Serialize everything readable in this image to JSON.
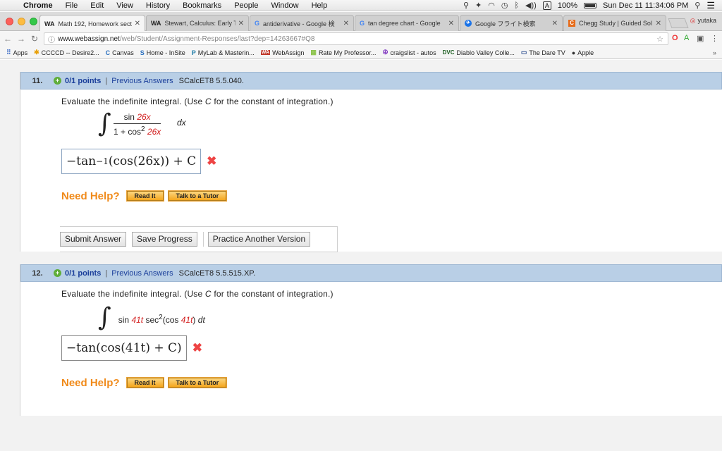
{
  "menubar": {
    "app": "Chrome",
    "items": [
      "File",
      "Edit",
      "View",
      "History",
      "Bookmarks",
      "People",
      "Window",
      "Help"
    ],
    "input_indicator": "A",
    "battery": "100%",
    "clock": "Sun Dec 11  11:34:06 PM"
  },
  "tabs": [
    {
      "favicon": "WA",
      "label": "Math 192, Homework secti"
    },
    {
      "favicon": "WA",
      "label": "Stewart, Calculus: Early Tr"
    },
    {
      "favicon": "G",
      "label": "antiderivative - Google 検"
    },
    {
      "favicon": "G",
      "label": "tan degree chart - Google"
    },
    {
      "favicon": "✈",
      "label": "Google フライト検索"
    },
    {
      "favicon": "C",
      "label": "Chegg Study | Guided Sol"
    }
  ],
  "profile": "yutaka",
  "address": {
    "host": "www.webassign.net",
    "path": "/web/Student/Assignment-Responses/last?dep=14263667#Q8"
  },
  "bookmarks": [
    {
      "icon": "⠿",
      "label": "Apps"
    },
    {
      "icon": "✱",
      "label": "CCCCD -- Desire2..."
    },
    {
      "icon": "C",
      "label": "Canvas"
    },
    {
      "icon": "S",
      "label": "Home - InSite"
    },
    {
      "icon": "P",
      "label": "MyLab & Masterin..."
    },
    {
      "icon": "WA",
      "label": "WebAssign"
    },
    {
      "icon": "▦",
      "label": "Rate My Professor..."
    },
    {
      "icon": "☮",
      "label": "craigslist - autos"
    },
    {
      "icon": "DVC",
      "label": "Diablo Valley Colle..."
    },
    {
      "icon": "▭",
      "label": "The Dare TV"
    },
    {
      "icon": "●",
      "label": "Apple"
    }
  ],
  "bookmarks_more": "»",
  "q11": {
    "number": "11.",
    "points": "0/1 points",
    "sep": "|",
    "prev": "Previous Answers",
    "id": "SCalcET8 5.5.040.",
    "prompt_pre": "Evaluate the indefinite integral. (Use ",
    "prompt_var": "C",
    "prompt_post": " for the constant of integration.)",
    "num_fn": "sin",
    "num_arg": "26x",
    "den_pre": "1 + cos",
    "den_exp": "2",
    "den_arg": "26x",
    "differential": "dx",
    "answer_func": "−tan",
    "answer_exp": "−1",
    "answer_rest": "(cos(26x)) + C",
    "need_help": "Need Help?",
    "read_it": "Read It",
    "talk_tutor": "Talk to a Tutor",
    "submit": "Submit Answer",
    "save": "Save Progress",
    "practice": "Practice Another Version"
  },
  "q12": {
    "number": "12.",
    "points": "0/1 points",
    "sep": "|",
    "prev": "Previous Answers",
    "id": "SCalcET8 5.5.515.XP.",
    "prompt_pre": "Evaluate the indefinite integral. (Use ",
    "prompt_var": "C",
    "prompt_post": " for the constant of integration.)",
    "int_fn": "sin",
    "int_arg": "41t",
    "int_mid": " sec",
    "int_exp": "2",
    "int_paren_open": "(cos ",
    "int_arg2": "41t",
    "int_paren_close": ")",
    "differential": "dt",
    "answer": "−tan(cos(41t) + C)",
    "need_help": "Need Help?",
    "read_it": "Read It",
    "talk_tutor": "Talk to a Tutor"
  }
}
